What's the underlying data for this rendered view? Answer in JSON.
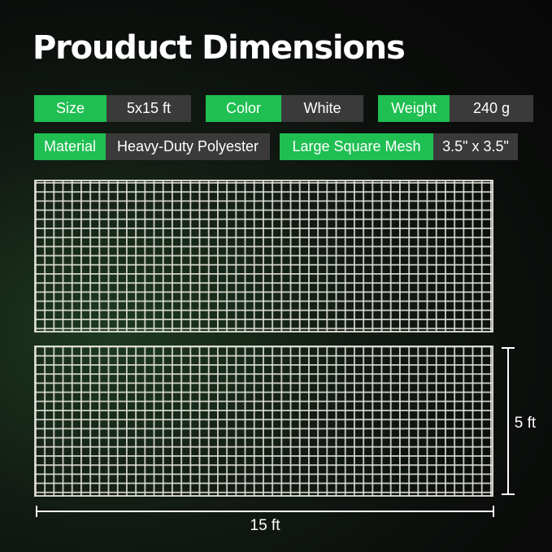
{
  "title": "Prouduct Dimensions",
  "specs": {
    "size": {
      "label": "Size",
      "value": "5x15 ft"
    },
    "color": {
      "label": "Color",
      "value": "White"
    },
    "weight": {
      "label": "Weight",
      "value": "240 g"
    },
    "material": {
      "label": "Material",
      "value": "Heavy-Duty Polyester"
    },
    "mesh": {
      "label": "Large Square Mesh",
      "value": "3.5\" x 3.5\""
    }
  },
  "dimensions": {
    "length": "15 ft",
    "height": "5 ft"
  },
  "colors": {
    "accent": "#1fbf52",
    "value_bg": "#3a3a3a",
    "net": "#e4e4dc"
  }
}
